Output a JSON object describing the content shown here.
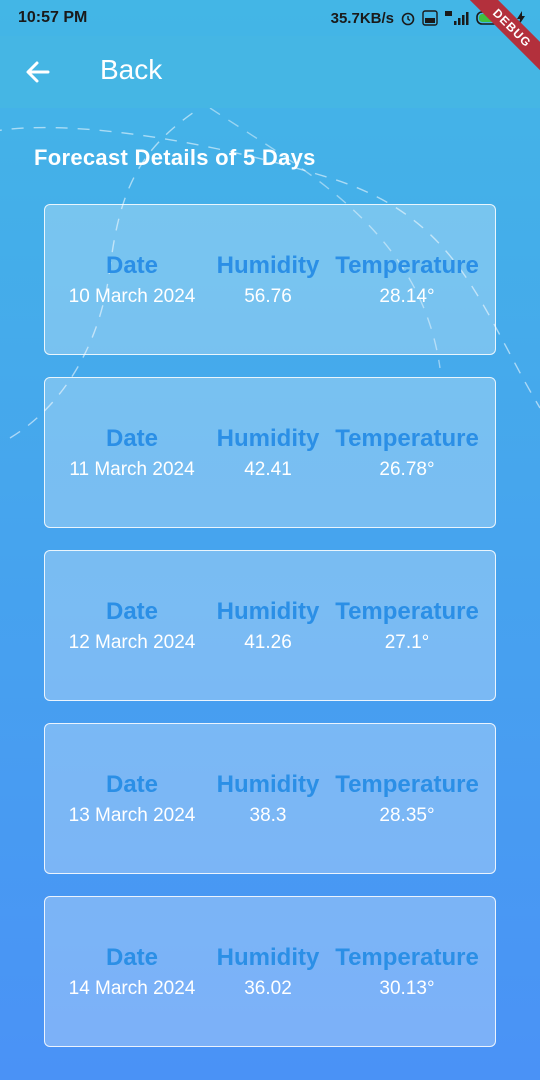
{
  "status": {
    "time": "10:57 PM",
    "speed": "35.7KB/s",
    "icons": [
      "alarm-icon",
      "volte-icon",
      "signal-icon",
      "battery-icon",
      "charging-icon"
    ]
  },
  "app_bar": {
    "back_label": "Back",
    "debug_label": "DEBUG"
  },
  "section_title": "Forecast Details of 5 Days",
  "labels": {
    "date": "Date",
    "humidity": "Humidity",
    "temperature": "Temperature"
  },
  "forecast": [
    {
      "date": "10 March 2024",
      "humidity": "56.76",
      "temperature": "28.14°"
    },
    {
      "date": "11 March 2024",
      "humidity": "42.41",
      "temperature": "26.78°"
    },
    {
      "date": "12 March 2024",
      "humidity": "41.26",
      "temperature": "27.1°"
    },
    {
      "date": "13 March 2024",
      "humidity": "38.3",
      "temperature": "28.35°"
    },
    {
      "date": "14 March 2024",
      "humidity": "36.02",
      "temperature": "30.13°"
    }
  ],
  "colors": {
    "label_blue": "#2b8fe6",
    "app_bar": "#45b6e4",
    "debug_ribbon": "#b3303c"
  }
}
